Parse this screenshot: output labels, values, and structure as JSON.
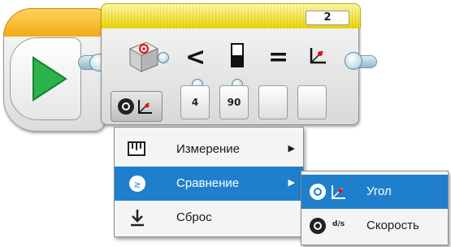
{
  "start_block": {
    "icon": "play-icon"
  },
  "compare_block": {
    "number": "2",
    "sensor_icon": "gyro-sensor-icon",
    "operator_left": "<",
    "operator_right": "=",
    "mode_icon": "angle-icon",
    "params": [
      "4",
      "90",
      "",
      ""
    ]
  },
  "mode_menu": {
    "items": [
      {
        "label": "Измерение",
        "icon": "measure-icon"
      },
      {
        "label": "Сравнение",
        "icon": "compare-icon"
      },
      {
        "label": "Сброс",
        "icon": "reset-icon"
      }
    ]
  },
  "submenu": {
    "items": [
      {
        "label": "Угол",
        "icon": "angle-icon"
      },
      {
        "label": "Скорость",
        "icon": "rate-icon",
        "rate_text": "d/s"
      }
    ]
  },
  "colors": {
    "accent": "#1f7fcc",
    "play": "#2bb34a",
    "header": "#e8d600"
  }
}
